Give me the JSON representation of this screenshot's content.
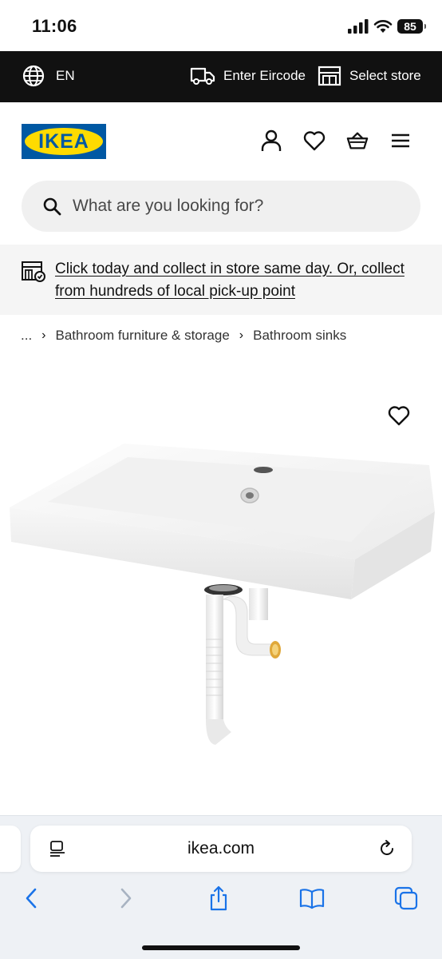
{
  "status_bar": {
    "time": "11:06",
    "battery": "85"
  },
  "top_bar": {
    "language": "EN",
    "eircode_label": "Enter Eircode",
    "store_label": "Select store"
  },
  "header": {
    "logo_text": "IKEA"
  },
  "search": {
    "placeholder": "What are you looking for?"
  },
  "banner": {
    "text": "Click today and collect in store same day. Or, collect from hundreds of local pick-up point"
  },
  "breadcrumb": {
    "ellipsis": "...",
    "items": [
      "Bathroom furniture & storage",
      "Bathroom sinks"
    ]
  },
  "browser": {
    "url": "ikea.com"
  },
  "colors": {
    "ikea_blue": "#0058a3",
    "ikea_yellow": "#ffdb00",
    "top_bar": "#111111",
    "safari_blue": "#1a73e8"
  }
}
